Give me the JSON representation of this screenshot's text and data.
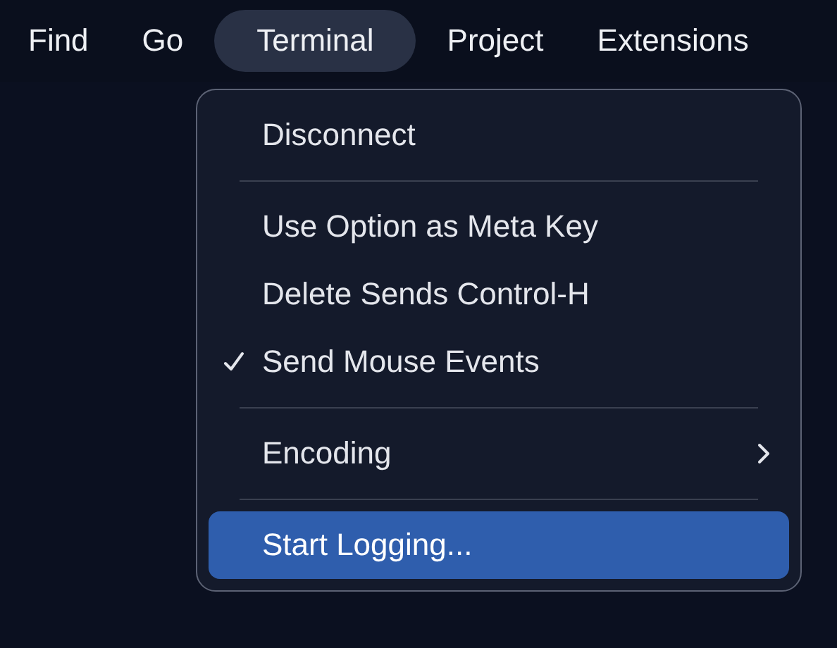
{
  "menubar": [
    {
      "label": "Find",
      "selected": false
    },
    {
      "label": "Go",
      "selected": false
    },
    {
      "label": "Terminal",
      "selected": true
    },
    {
      "label": "Project",
      "selected": false
    },
    {
      "label": "Extensions",
      "selected": false
    }
  ],
  "menu": [
    {
      "kind": "item",
      "label": "Disconnect",
      "checked": false,
      "submenu": false,
      "selected": false
    },
    {
      "kind": "separator"
    },
    {
      "kind": "item",
      "label": "Use Option as Meta Key",
      "checked": false,
      "submenu": false,
      "selected": false
    },
    {
      "kind": "item",
      "label": "Delete Sends Control-H",
      "checked": false,
      "submenu": false,
      "selected": false
    },
    {
      "kind": "item",
      "label": "Send Mouse Events",
      "checked": true,
      "submenu": false,
      "selected": false
    },
    {
      "kind": "separator"
    },
    {
      "kind": "item",
      "label": "Encoding",
      "checked": false,
      "submenu": true,
      "selected": false
    },
    {
      "kind": "separator"
    },
    {
      "kind": "item",
      "label": "Start Logging...",
      "checked": false,
      "submenu": false,
      "selected": true
    }
  ]
}
